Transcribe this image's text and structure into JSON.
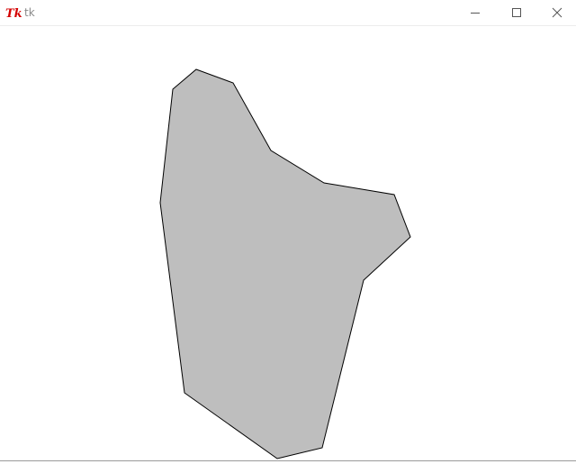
{
  "window": {
    "title": "tk",
    "app_icon": "tk-feather-icon",
    "controls": {
      "minimize_icon": "minimize-icon",
      "maximize_icon": "maximize-icon",
      "close_icon": "close-icon"
    }
  },
  "canvas": {
    "background": "#ffffff",
    "shape": {
      "type": "polygon",
      "fill": "#bebebe",
      "outline": "#000000"
    }
  }
}
